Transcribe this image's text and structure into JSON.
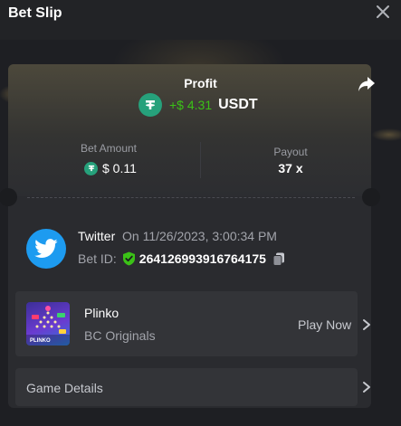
{
  "header": {
    "title": "Bet Slip"
  },
  "profit": {
    "label": "Profit",
    "amount": "+$ 4.31",
    "currency": "USDT"
  },
  "bet_amount": {
    "label": "Bet Amount",
    "value": "$ 0.11"
  },
  "payout": {
    "label": "Payout",
    "value": "37 x"
  },
  "user": {
    "name": "Twitter",
    "date": "On 11/26/2023, 3:00:34 PM",
    "bet_id_label": "Bet ID:",
    "bet_id": "264126993916764175"
  },
  "game": {
    "name": "Plinko",
    "provider": "BC Originals",
    "action": "Play Now",
    "thumb_text": "PLINKO"
  },
  "details": {
    "label": "Game Details"
  },
  "colors": {
    "profit_green": "#3bc117",
    "usdt_green": "#26a17b",
    "twitter_blue": "#1d9bf0"
  }
}
